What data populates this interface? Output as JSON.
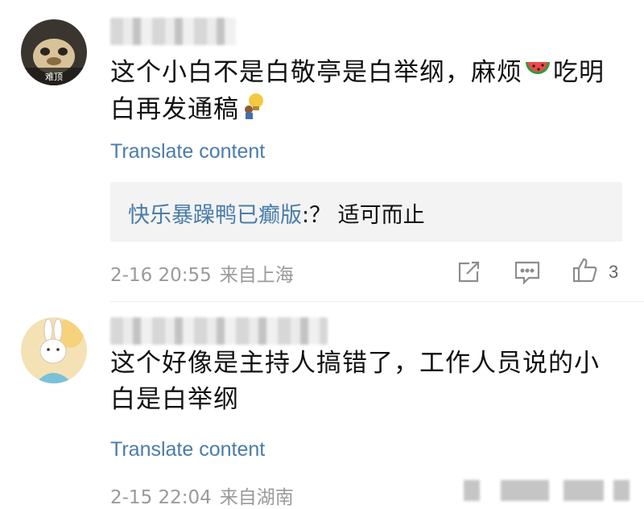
{
  "comments": [
    {
      "avatar_badge": "难顶",
      "text_before": "这个小白不是白敬亭是白举纲，麻烦",
      "text_middle": "吃明白再发通稿",
      "translate_label": "Translate content",
      "reply": {
        "author": "快乐暴躁鸭已癫版",
        "text": ":？ 适可而止"
      },
      "time": "2-16 20:55",
      "location": "来自上海",
      "like_count": "3",
      "icons": [
        "share-icon",
        "comment-icon",
        "like-icon"
      ]
    },
    {
      "text": "这个好像是主持人搞错了，工作人员说的小白是白举纲",
      "translate_label": "Translate content",
      "time": "2-15 22:04",
      "location": "来自湖南"
    }
  ],
  "colors": {
    "link": "#4a7caa",
    "meta": "#9a9a9a",
    "reply_bg": "#f3f3f3"
  }
}
